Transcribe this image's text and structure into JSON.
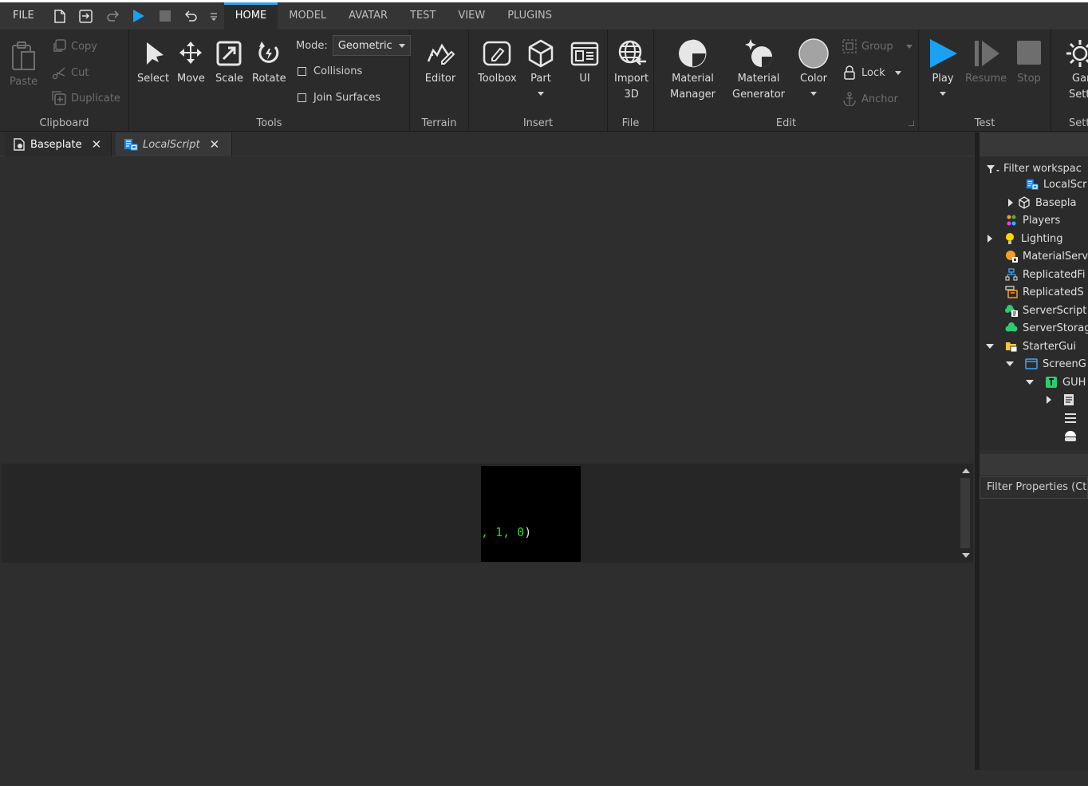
{
  "menu": {
    "file": "FILE",
    "tabs": [
      "HOME",
      "MODEL",
      "AVATAR",
      "TEST",
      "VIEW",
      "PLUGINS"
    ],
    "active_tab": "HOME"
  },
  "ribbon": {
    "clipboard": {
      "label": "Clipboard",
      "paste": "Paste",
      "copy": "Copy",
      "cut": "Cut",
      "duplicate": "Duplicate"
    },
    "tools": {
      "label": "Tools",
      "select": "Select",
      "move": "Move",
      "scale": "Scale",
      "rotate": "Rotate",
      "mode_label": "Mode:",
      "mode_value": "Geometric",
      "collisions": "Collisions",
      "join_surfaces": "Join Surfaces"
    },
    "terrain": {
      "label": "Terrain",
      "editor": "Editor"
    },
    "insert": {
      "label": "Insert",
      "toolbox": "Toolbox",
      "part": "Part",
      "ui": "UI"
    },
    "file": {
      "label": "File",
      "import_3d_line1": "Import",
      "import_3d_line2": "3D"
    },
    "edit": {
      "label": "Edit",
      "material_manager_1": "Material",
      "material_manager_2": "Manager",
      "material_generator_1": "Material",
      "material_generator_2": "Generator",
      "color": "Color",
      "group": "Group",
      "lock": "Lock",
      "anchor": "Anchor"
    },
    "test": {
      "label": "Test",
      "play": "Play",
      "resume": "Resume",
      "stop": "Stop"
    },
    "settings": {
      "label": "Setti",
      "game_line1": "Gar",
      "game_line2": "Setti"
    }
  },
  "doc_tabs": [
    {
      "label": "Baseplate",
      "active": true
    },
    {
      "label": "LocalScript",
      "active": false
    }
  ],
  "output": {
    "text_white_1": ", ",
    "text_green_1": "1",
    "text_white_2": ", ",
    "text_green_2": "0",
    "text_white_3": ")"
  },
  "explorer": {
    "filter_placeholder": "Filter workspac",
    "items": [
      {
        "label": "LocalScr",
        "icon": "localscript-icon"
      },
      {
        "label": "Basepla",
        "icon": "part-icon"
      },
      {
        "label": "Players",
        "icon": "players-icon"
      },
      {
        "label": "Lighting",
        "icon": "lighting-icon"
      },
      {
        "label": "MaterialServ",
        "icon": "materialservice-icon"
      },
      {
        "label": "ReplicatedFi",
        "icon": "replicatedfirst-icon"
      },
      {
        "label": "ReplicatedS",
        "icon": "replicatedstorage-icon"
      },
      {
        "label": "ServerScript",
        "icon": "serverscriptservice-icon"
      },
      {
        "label": "ServerStorag",
        "icon": "serverstorage-icon"
      },
      {
        "label": "StarterGui",
        "icon": "startergui-icon"
      },
      {
        "label": "ScreenG",
        "icon": "screengui-icon"
      },
      {
        "label": "GUH",
        "icon": "textlabel-icon"
      }
    ]
  },
  "properties": {
    "filter_placeholder": "Filter Properties (Ctr"
  },
  "colors": {
    "accent": "#35a2f3",
    "play_blue": "#1aa1f2",
    "code_green": "#2bd62b"
  }
}
